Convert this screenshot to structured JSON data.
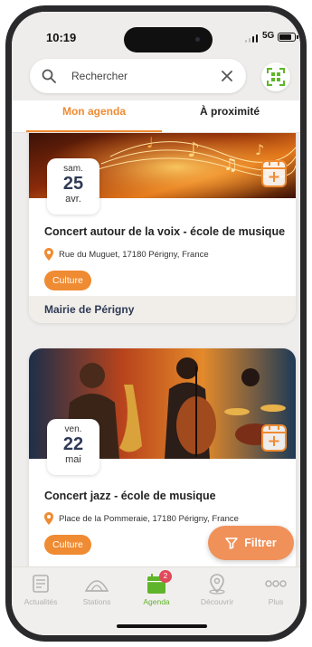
{
  "status": {
    "time": "10:19",
    "network": "5G"
  },
  "search": {
    "placeholder": "Rechercher"
  },
  "tabs": [
    {
      "label": "Mon agenda",
      "active": true
    },
    {
      "label": "À proximité",
      "active": false
    }
  ],
  "events": [
    {
      "weekday": "sam.",
      "day": "25",
      "month": "avr.",
      "title": "Concert autour de la voix - école de musique",
      "location": "Rue du Muguet, 17180 Périgny, France",
      "tag": "Culture",
      "organizer": "Mairie de Périgny",
      "image": "music-notes-fire"
    },
    {
      "weekday": "ven.",
      "day": "22",
      "month": "mai",
      "title": "Concert jazz - école de musique",
      "location": "Place de la Pommeraie, 17180 Périgny, France",
      "tag": "Culture",
      "image": "jazz-band-painting"
    }
  ],
  "filter_button": {
    "label": "Filtrer"
  },
  "nav": [
    {
      "label": "Actualités",
      "icon": "news-icon",
      "active": false
    },
    {
      "label": "Stations",
      "icon": "stations-icon",
      "active": false
    },
    {
      "label": "Agenda",
      "icon": "agenda-icon",
      "active": true,
      "badge": "2"
    },
    {
      "label": "Découvrir",
      "icon": "map-pin-icon",
      "active": false
    },
    {
      "label": "Plus",
      "icon": "more-icon",
      "active": false
    }
  ],
  "colors": {
    "accent": "#ef8b32",
    "active_nav": "#5fb52a",
    "badge": "#e04a5a",
    "title_dark": "#2f3a55"
  }
}
